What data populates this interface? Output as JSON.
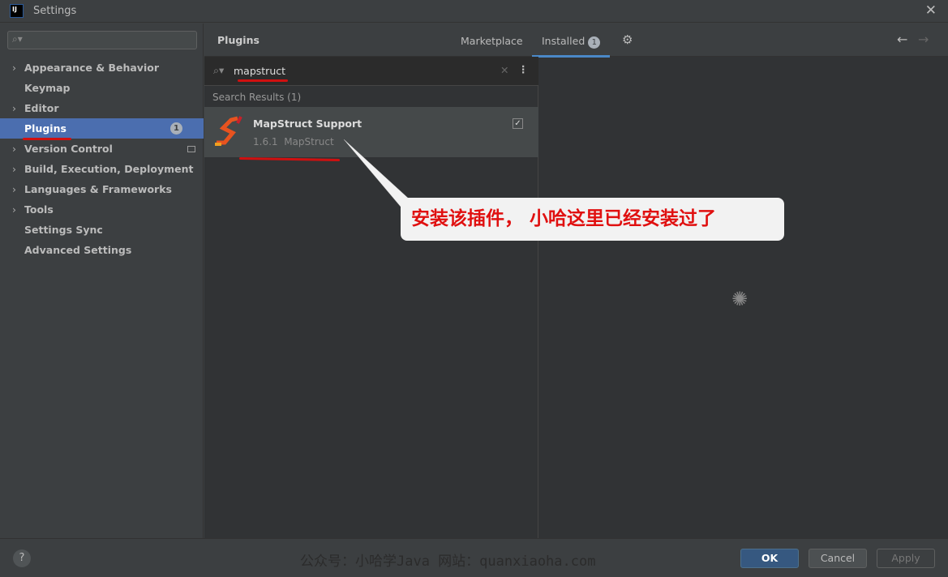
{
  "window": {
    "title": "Settings",
    "logo_text": "IJ"
  },
  "sidebar": {
    "search_placeholder": "",
    "items": [
      {
        "label": "Appearance & Behavior",
        "expandable": true
      },
      {
        "label": "Keymap",
        "expandable": false
      },
      {
        "label": "Editor",
        "expandable": true
      },
      {
        "label": "Plugins",
        "expandable": false,
        "selected": true,
        "badge": "1"
      },
      {
        "label": "Version Control",
        "expandable": true
      },
      {
        "label": "Build, Execution, Deployment",
        "expandable": true
      },
      {
        "label": "Languages & Frameworks",
        "expandable": true
      },
      {
        "label": "Tools",
        "expandable": true
      },
      {
        "label": "Settings Sync",
        "expandable": false
      },
      {
        "label": "Advanced Settings",
        "expandable": false
      }
    ]
  },
  "header": {
    "title": "Plugins",
    "tabs": [
      {
        "label": "Marketplace"
      },
      {
        "label": "Installed",
        "badge": "1",
        "active": true
      }
    ]
  },
  "search": {
    "value": "mapstruct"
  },
  "results": {
    "label": "Search Results (1)",
    "plugins": [
      {
        "name": "MapStruct Support",
        "version": "1.6.1",
        "vendor": "MapStruct",
        "enabled": true
      }
    ]
  },
  "annotation": {
    "text": "安装该插件， 小哈这里已经安装过了"
  },
  "footer": {
    "watermark": "公众号：小哈学Java 网站：quanxiaoha.com",
    "ok": "OK",
    "cancel": "Cancel",
    "apply": "Apply"
  },
  "colors": {
    "accent": "#4b6eaf",
    "annotation": "#e01010"
  }
}
